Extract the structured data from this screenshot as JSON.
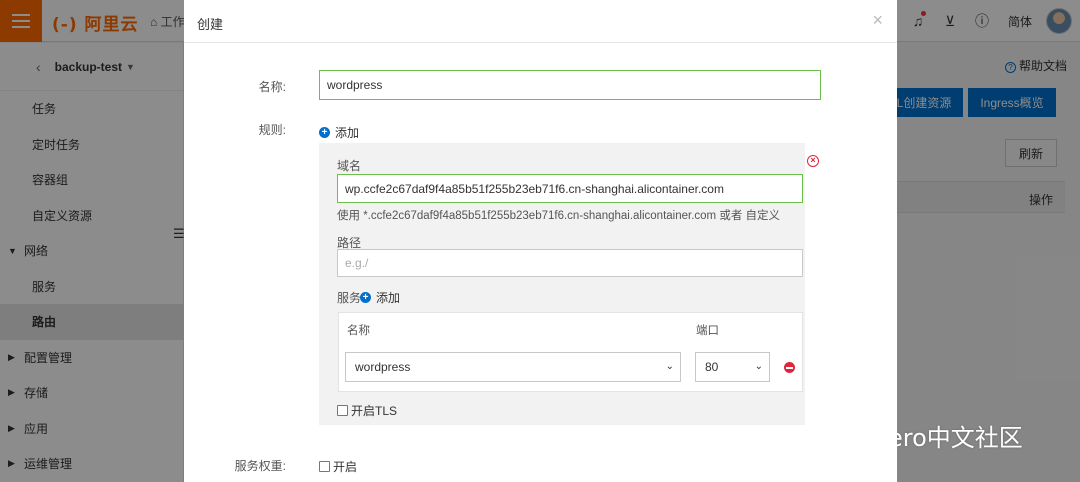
{
  "topbar": {
    "logo": "(-) 阿里云",
    "workbench": "⌂ 工作",
    "lang": "简体"
  },
  "sidebar": {
    "cluster": "backup-test",
    "items": [
      {
        "label": "任务",
        "type": "item"
      },
      {
        "label": "定时任务",
        "type": "item"
      },
      {
        "label": "容器组",
        "type": "item"
      },
      {
        "label": "自定义资源",
        "type": "item"
      },
      {
        "label": "网络",
        "type": "group-open"
      },
      {
        "label": "服务",
        "type": "item"
      },
      {
        "label": "路由",
        "type": "item-active"
      },
      {
        "label": "配置管理",
        "type": "group"
      },
      {
        "label": "存储",
        "type": "group"
      },
      {
        "label": "应用",
        "type": "group"
      },
      {
        "label": "运维管理",
        "type": "group"
      }
    ]
  },
  "main": {
    "help": "帮助文档",
    "yaml_create": "L创建资源",
    "ingress_overview": "Ingress概览",
    "refresh": "刷新",
    "col_actions": "操作"
  },
  "watermark": "Velero中文社区",
  "dialog": {
    "title": "创建",
    "close": "×",
    "name_label": "名称:",
    "name_value": "wordpress",
    "rules_label": "规则:",
    "add": "添加",
    "domain_label": "域名",
    "domain_value": "wp.ccfe2c67daf9f4a85b51f255b23eb71f6.cn-shanghai.alicontainer.com",
    "domain_hint": "使用 *.ccfe2c67daf9f4a85b51f255b23eb71f6.cn-shanghai.alicontainer.com 或者 自定义",
    "path_label": "路径",
    "path_placeholder": "e.g./",
    "service_label": "服务",
    "service_add": "添加",
    "col_name": "名称",
    "col_port": "端口",
    "service_name": "wordpress",
    "service_port": "80",
    "tls_label": "开启TLS",
    "weight_label": "服务权重:",
    "weight_enable": "开启"
  },
  "colors": {
    "brand": "#ff6a00",
    "primary": "#0070cc",
    "focus_border": "#6cbf4a",
    "danger": "#e0243a"
  }
}
